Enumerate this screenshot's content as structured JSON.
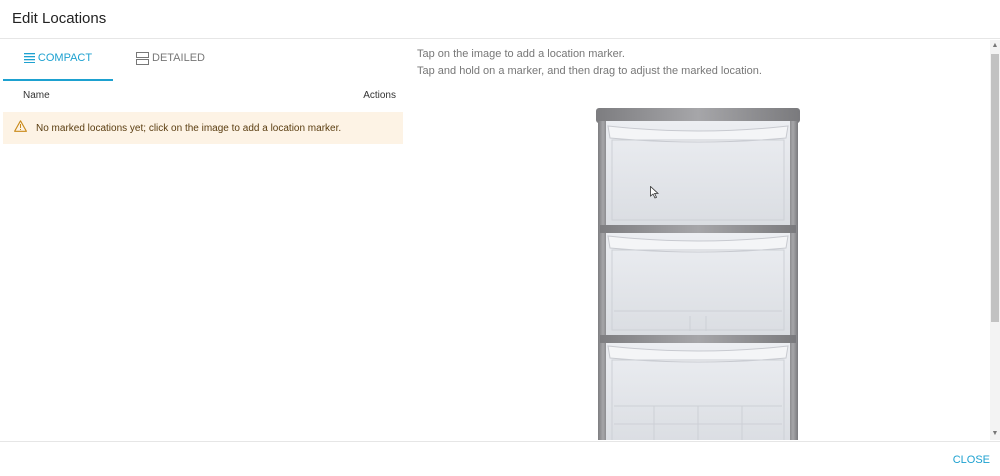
{
  "dialog": {
    "title": "Edit Locations"
  },
  "tabs": [
    {
      "label": "COMPACT",
      "icon": "list-icon",
      "active": true
    },
    {
      "label": "DETAILED",
      "icon": "card-list-icon",
      "active": false
    }
  ],
  "table": {
    "columns": [
      "Name",
      "Actions"
    ]
  },
  "notice": {
    "icon": "warning-icon",
    "message": "No marked locations yet; click on the image to add a location marker."
  },
  "instructions": [
    "Tap on the image to add a location marker.",
    "Tap and hold on a marker, and then drag to adjust the marked location."
  ],
  "image": {
    "subject": "plastic drawer storage unit"
  },
  "footer": {
    "close_label": "CLOSE"
  },
  "colors": {
    "accent": "#1da1d0",
    "notice_bg": "#fdf3e5",
    "warning": "#c98a1a"
  }
}
